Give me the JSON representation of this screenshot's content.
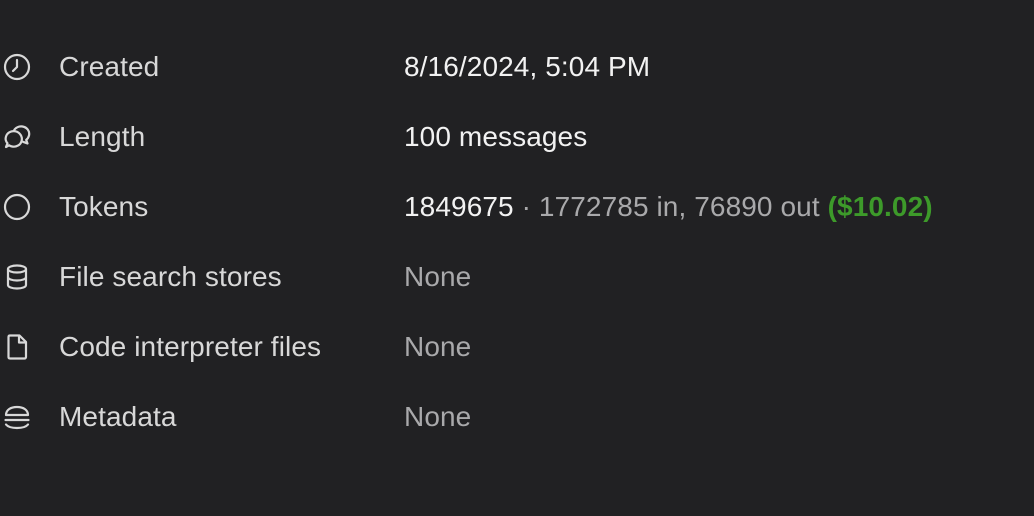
{
  "colors": {
    "background": "#212123",
    "label": "#d8d8d8",
    "value": "#f2f2f2",
    "muted": "#a9a9ab",
    "price": "#3d9a2a"
  },
  "rows": [
    {
      "icon": "clock-icon",
      "label": "Created",
      "value": "8/16/2024, 5:04 PM"
    },
    {
      "icon": "chat-bubbles-icon",
      "label": "Length",
      "value": "100 messages"
    },
    {
      "icon": "circle-icon",
      "label": "Tokens",
      "value_total": "1849675",
      "value_sep": " · ",
      "value_breakdown": "1772785 in, 76890 out",
      "value_cost": "($10.02)"
    },
    {
      "icon": "database-icon",
      "label": "File search stores",
      "value": "None"
    },
    {
      "icon": "file-icon",
      "label": "Code interpreter files",
      "value": "None"
    },
    {
      "icon": "stack-icon",
      "label": "Metadata",
      "value": "None"
    }
  ]
}
